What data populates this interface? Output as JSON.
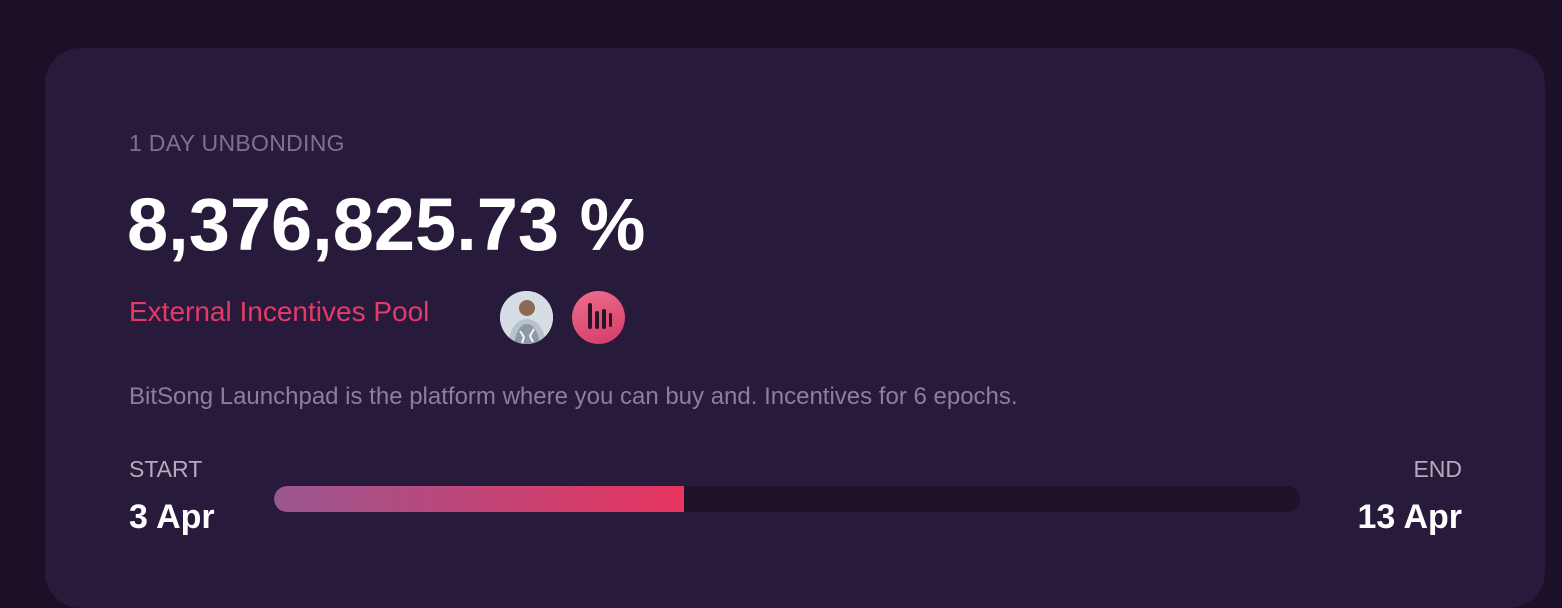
{
  "card": {
    "unbonding_label": "1 DAY UNBONDING",
    "apr_value": "8,376,825.73 %",
    "pool_name": "External Incentives Pool",
    "tokens": [
      {
        "name": "artist-avatar-icon"
      },
      {
        "name": "bitsong-logo-icon"
      }
    ],
    "description": "BitSong Launchpad is the platform where you can buy and. Incentives for 6 epochs.",
    "progress": {
      "start_label": "START",
      "start_date": "3 Apr",
      "end_label": "END",
      "end_date": "13 Apr",
      "fraction": 0.4
    }
  },
  "colors": {
    "background": "#1c1029",
    "card": "#281a3a",
    "accent": "#e6396a",
    "gradient_start": "#9a5690",
    "gradient_end": "#e6355f"
  }
}
